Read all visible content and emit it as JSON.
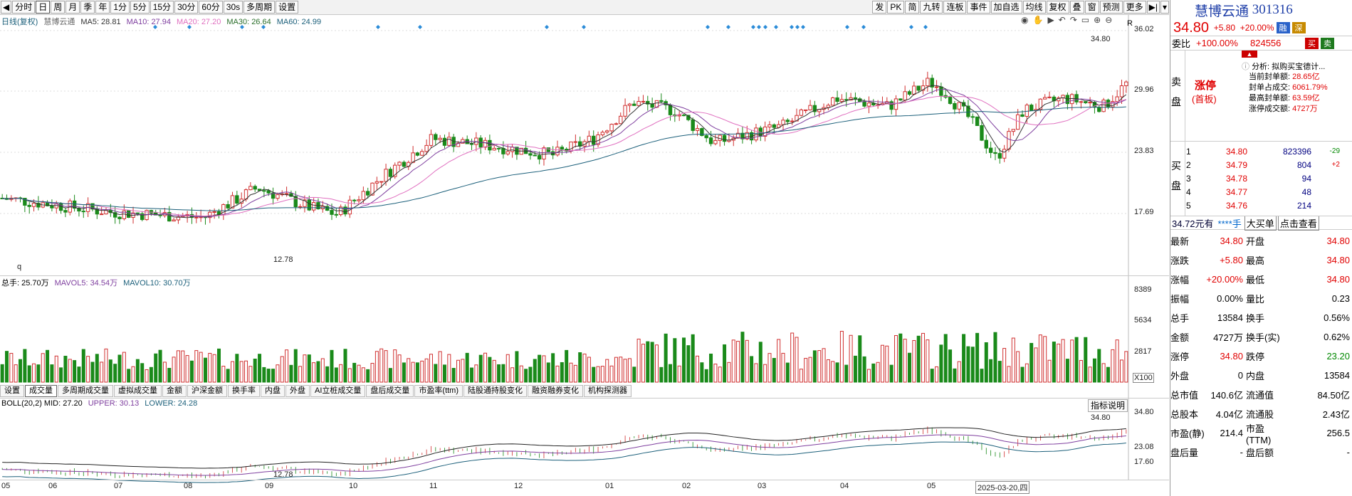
{
  "toolbar": {
    "left": [
      "分时",
      "日",
      "周",
      "月",
      "季",
      "年",
      "1分",
      "5分",
      "15分",
      "30分",
      "60分",
      "30s",
      "多周期",
      "设置"
    ],
    "active": "日",
    "right": [
      "发",
      "PK",
      "简",
      "九转",
      "连板",
      "事件",
      "加自选",
      "均线",
      "复权",
      "叠",
      "窗",
      "预测",
      "更多"
    ]
  },
  "kline": {
    "indicator_name": "日线(复权)",
    "stock": "慧博云通",
    "ma": [
      "MA5: 28.81",
      "MA10: 27.94",
      "MA20: 27.20",
      "MA30: 26.64",
      "MA60: 24.99"
    ],
    "ma_colors": [
      "#333333",
      "#7f3f9f",
      "#e070c0",
      "#2a6e2a",
      "#1b5f7a"
    ],
    "y_ticks": [
      "36.02",
      "29.96",
      "23.83",
      "17.69"
    ],
    "high_label": "34.80",
    "low_label": "12.78",
    "q_label": "q"
  },
  "volume": {
    "info": [
      "总手: 25.70万",
      "MAVOL5: 34.54万",
      "MAVOL10: 30.70万"
    ],
    "y_ticks": [
      "8389",
      "5634",
      "2817"
    ],
    "unit": "X100"
  },
  "tabs": [
    "设置",
    "成交量",
    "多周期成交量",
    "虚拟成交量",
    "金额",
    "沪深金额",
    "换手率",
    "内盘",
    "外盘",
    "AI立桩成交量",
    "盘后成交量",
    "市盈率(ttm)",
    "陆股通持股变化",
    "融资融券变化",
    "机构探测器"
  ],
  "active_tab": "成交量",
  "boll": {
    "info": [
      "BOLL(20,2) MID: 27.20",
      "UPPER: 30.13",
      "LOWER: 24.28"
    ],
    "y_ticks": [
      "34.80",
      "23.08",
      "17.60"
    ],
    "high_label": "34.80",
    "low_label": "12.78",
    "indicator_btn": "指标说明"
  },
  "x_axis": [
    "05",
    "06",
    "07",
    "08",
    "09",
    "10",
    "11",
    "12",
    "01",
    "02",
    "03",
    "04",
    "05"
  ],
  "x_date_label": "2025-03-20,四",
  "quote": {
    "name": "慧博云通",
    "code": "301316",
    "price": "34.80",
    "change": "+5.80",
    "pct": "+20.00%",
    "tag1": "融",
    "tag2": "深",
    "weibi_label": "委比",
    "weibi": "+100.00%",
    "weicha": "824556",
    "buy": "买",
    "sell": "卖",
    "sell_label": "卖盘",
    "limit_title": "涨停",
    "limit_sub": "(首板)",
    "analysis": "分析:  拟购买宝德计...",
    "stats": [
      {
        "k": "当前封单额:",
        "v": "28.65亿"
      },
      {
        "k": "封单占成交:",
        "v": "6061.79%"
      },
      {
        "k": "最高封单额:",
        "v": "63.59亿"
      },
      {
        "k": "涨停成交额:",
        "v": "4727万"
      }
    ],
    "buy_label": "买盘",
    "bids": [
      {
        "n": "1",
        "p": "34.80",
        "v": "823396",
        "d": "-29"
      },
      {
        "n": "2",
        "p": "34.79",
        "v": "804",
        "d": "+2"
      },
      {
        "n": "3",
        "p": "34.78",
        "v": "94",
        "d": ""
      },
      {
        "n": "4",
        "p": "34.77",
        "v": "48",
        "d": ""
      },
      {
        "n": "5",
        "p": "34.76",
        "v": "214",
        "d": ""
      }
    ],
    "bar": [
      "34.72元有",
      "****手",
      "大买单",
      "点击查看"
    ],
    "fields": [
      {
        "k1": "最新",
        "v1": "34.80",
        "k2": "开盘",
        "v2": "34.80"
      },
      {
        "k1": "涨跌",
        "v1": "+5.80",
        "k2": "最高",
        "v2": "34.80"
      },
      {
        "k1": "涨幅",
        "v1": "+20.00%",
        "k2": "最低",
        "v2": "34.80"
      },
      {
        "k1": "振幅",
        "v1": "0.00%",
        "k2": "量比",
        "v2": "0.23"
      },
      {
        "k1": "总手",
        "v1": "13584",
        "k2": "换手",
        "v2": "0.56%"
      },
      {
        "k1": "金额",
        "v1": "4727万",
        "k2": "换手(实)",
        "v2": "0.62%"
      },
      {
        "k1": "涨停",
        "v1": "34.80",
        "k2": "跌停",
        "v2": "23.20"
      },
      {
        "k1": "外盘",
        "v1": "0",
        "k2": "内盘",
        "v2": "13584"
      },
      {
        "k1": "总市值",
        "v1": "140.6亿",
        "k2": "流通值",
        "v2": "84.50亿"
      },
      {
        "k1": "总股本",
        "v1": "4.04亿",
        "k2": "流通股",
        "v2": "2.43亿"
      },
      {
        "k1": "市盈(静)",
        "v1": "214.4",
        "k2": "市盈(TTM)",
        "v2": "256.5"
      },
      {
        "k1": "盘后量",
        "v1": "-",
        "k2": "盘后额",
        "v2": "-"
      }
    ]
  }
}
